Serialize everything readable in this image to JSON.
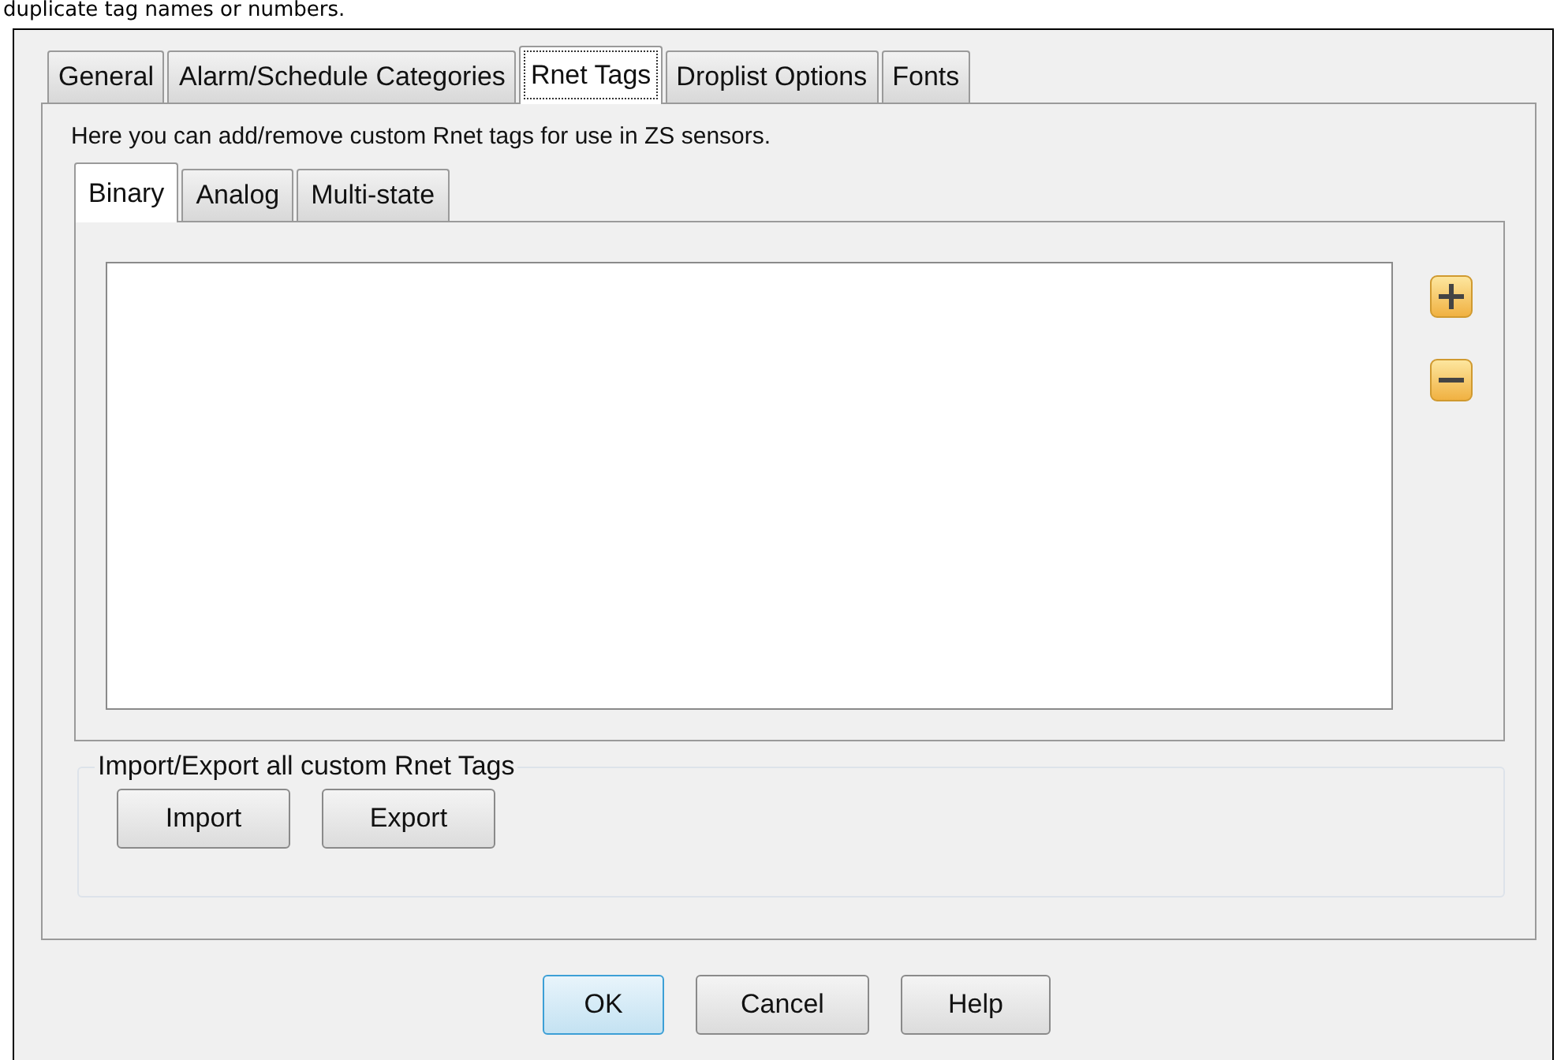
{
  "header_text": "duplicate tag names or numbers.",
  "tabs": [
    {
      "label": "General",
      "selected": false
    },
    {
      "label": "Alarm/Schedule Categories",
      "selected": false
    },
    {
      "label": "Rnet Tags",
      "selected": true
    },
    {
      "label": "Droplist Options",
      "selected": false
    },
    {
      "label": "Fonts",
      "selected": false
    }
  ],
  "description": "Here you can add/remove custom Rnet tags for use in ZS sensors.",
  "subtabs": [
    {
      "label": "Binary",
      "selected": true
    },
    {
      "label": "Analog",
      "selected": false
    },
    {
      "label": "Multi-state",
      "selected": false
    }
  ],
  "side_buttons": [
    {
      "kind": "add"
    },
    {
      "kind": "remove"
    }
  ],
  "group": {
    "title": "Import/Export all custom Rnet Tags",
    "buttons": [
      {
        "label": "Import"
      },
      {
        "label": "Export"
      }
    ]
  },
  "dialog_buttons": [
    {
      "label": "OK",
      "default": true
    },
    {
      "label": "Cancel",
      "default": false
    },
    {
      "label": "Help",
      "default": false
    }
  ]
}
